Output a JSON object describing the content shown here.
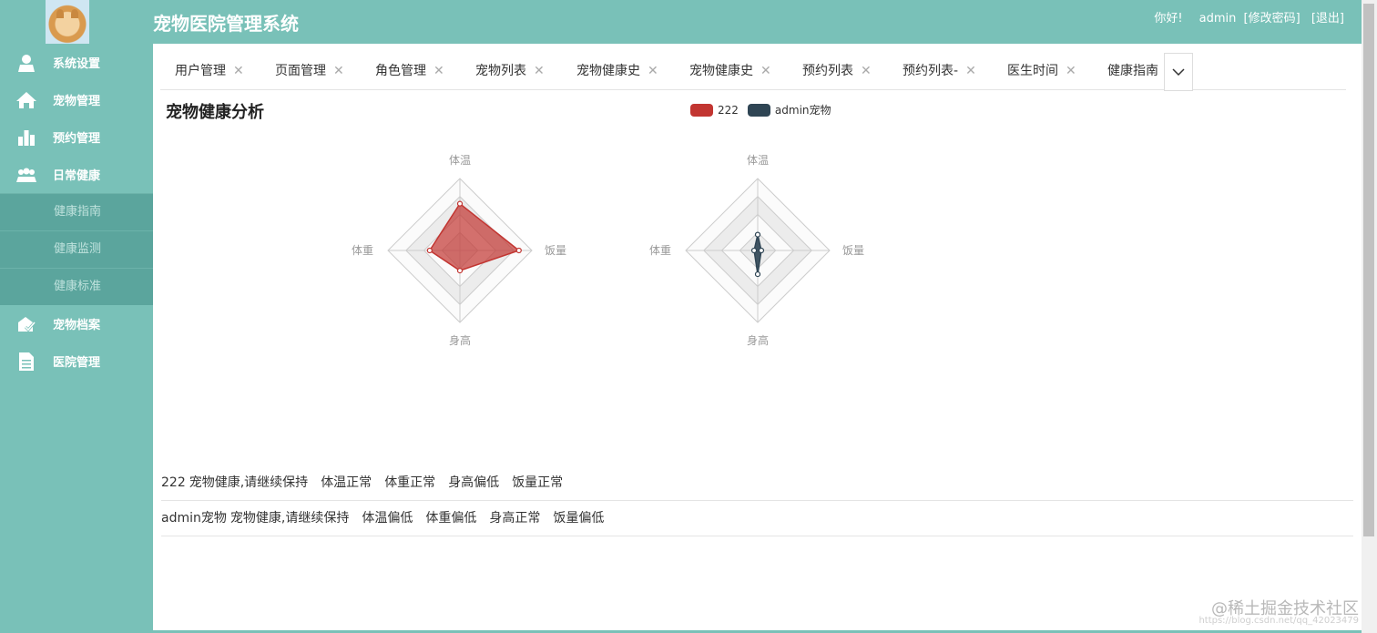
{
  "header": {
    "app_title": "宠物医院管理系统",
    "greeting": "你好!",
    "username": "admin",
    "change_password": "[修改密码]",
    "logout": "[退出]"
  },
  "sidebar": {
    "items": [
      {
        "label": "系统设置",
        "icon": "user-icon"
      },
      {
        "label": "宠物管理",
        "icon": "home-icon"
      },
      {
        "label": "预约管理",
        "icon": "bar-chart-icon"
      },
      {
        "label": "日常健康",
        "icon": "group-icon"
      },
      {
        "label": "宠物档案",
        "icon": "pet-file-icon"
      },
      {
        "label": "医院管理",
        "icon": "document-icon"
      }
    ],
    "submenu": [
      {
        "label": "健康指南"
      },
      {
        "label": "健康监测"
      },
      {
        "label": "健康标准"
      }
    ]
  },
  "tabs": [
    {
      "label": "用户管理"
    },
    {
      "label": "页面管理"
    },
    {
      "label": "角色管理"
    },
    {
      "label": "宠物列表"
    },
    {
      "label": "宠物健康史"
    },
    {
      "label": "宠物健康史"
    },
    {
      "label": "预约列表"
    },
    {
      "label": "预约列表-"
    },
    {
      "label": "医生时间"
    },
    {
      "label": "健康指南"
    }
  ],
  "page_title": "宠物健康分析",
  "colors": {
    "accent": "#79c1b8",
    "series_1": "#c23531",
    "series_2": "#2f4554"
  },
  "chart_data": {
    "type": "radar",
    "indicators": [
      "体温",
      "饭量",
      "身高",
      "体重"
    ],
    "legend": [
      "222",
      "admin宠物"
    ],
    "series": [
      {
        "name": "222",
        "values": [
          0.65,
          0.82,
          0.28,
          0.42
        ]
      },
      {
        "name": "admin宠物",
        "values": [
          0.22,
          0.05,
          0.33,
          0.05
        ]
      }
    ],
    "grid_levels": 4
  },
  "results": [
    {
      "name": "222",
      "summary": "宠物健康,请继续保持",
      "items": [
        "体温正常",
        "体重正常",
        "身高偏低",
        "饭量正常"
      ]
    },
    {
      "name": "admin宠物",
      "summary": "宠物健康,请继续保持",
      "items": [
        "体温偏低",
        "体重偏低",
        "身高正常",
        "饭量偏低"
      ]
    }
  ],
  "watermark": {
    "text": "@稀土掘金技术社区",
    "url": "https://blog.csdn.net/qq_42023479"
  }
}
